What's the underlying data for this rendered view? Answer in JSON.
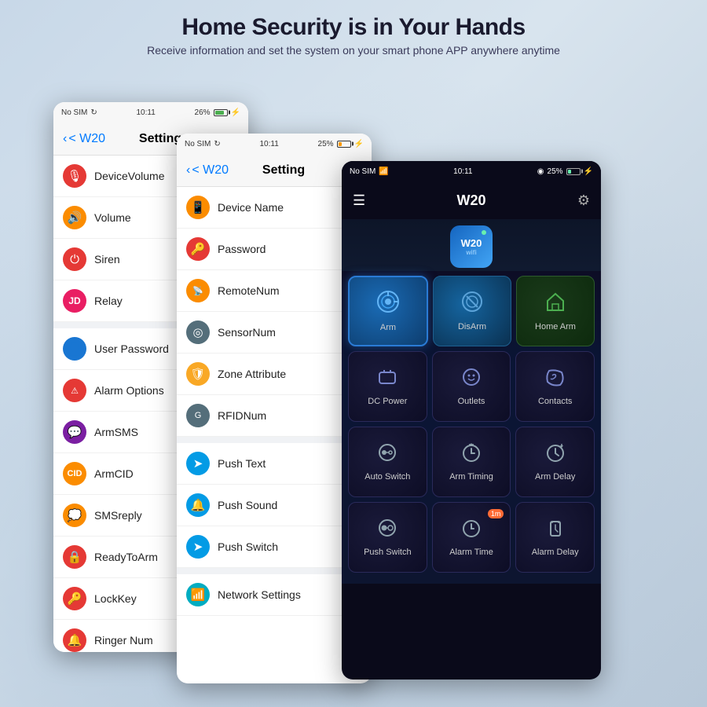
{
  "header": {
    "title": "Home Security is in Your Hands",
    "subtitle": "Receive information and set the system on your smart phone APP anywhere anytime"
  },
  "screen1": {
    "status": {
      "sim": "No SIM",
      "time": "10:11",
      "battery": "26%"
    },
    "nav": {
      "back": "< W20",
      "title": "Setting"
    },
    "items": [
      {
        "label": "DeviceVolume",
        "icon": "mic",
        "color": "icon-red"
      },
      {
        "label": "Volume",
        "icon": "volume",
        "color": "icon-orange",
        "hasBar": true
      },
      {
        "label": "Siren",
        "icon": "power",
        "color": "icon-red"
      },
      {
        "label": "Relay",
        "icon": "relay",
        "color": "icon-pink"
      },
      {
        "label": "User Password",
        "icon": "user",
        "color": "icon-blue"
      },
      {
        "label": "Alarm Options",
        "icon": "alarm",
        "color": "icon-red"
      },
      {
        "label": "ArmSMS",
        "icon": "sms",
        "color": "icon-purple"
      },
      {
        "label": "ArmCID",
        "icon": "cid",
        "color": "icon-orange"
      },
      {
        "label": "SMSreply",
        "icon": "reply",
        "color": "icon-orange"
      },
      {
        "label": "ReadyToArm",
        "icon": "ready",
        "color": "icon-red"
      },
      {
        "label": "LockKey",
        "icon": "lock",
        "color": "icon-red"
      },
      {
        "label": "Ringer Num",
        "icon": "ringer",
        "color": "icon-red"
      }
    ]
  },
  "screen2": {
    "status": {
      "sim": "No SIM",
      "time": "10:11",
      "battery": "25%"
    },
    "nav": {
      "back": "< W20",
      "title": "Setting"
    },
    "items": [
      {
        "label": "Device Name",
        "icon": "device",
        "color": "icon-orange"
      },
      {
        "label": "Password",
        "icon": "key",
        "color": "icon-red"
      },
      {
        "label": "RemoteNum",
        "icon": "remote",
        "color": "icon-orange"
      },
      {
        "label": "SensorNum",
        "icon": "sensor",
        "color": "icon-gray"
      },
      {
        "label": "Zone Attribute",
        "icon": "zone",
        "color": "icon-amber"
      },
      {
        "label": "RFIDNum",
        "icon": "rfid",
        "color": "icon-gray"
      },
      {
        "label": "Push Text",
        "icon": "pushtext",
        "color": "icon-blue"
      },
      {
        "label": "Push Sound",
        "icon": "pushsound",
        "color": "icon-blue"
      },
      {
        "label": "Push Switch",
        "icon": "pushswitch",
        "color": "icon-blue"
      },
      {
        "label": "Network Settings",
        "icon": "network",
        "color": "icon-cyan"
      }
    ]
  },
  "screen3": {
    "status": {
      "sim": "No SIM",
      "time": "10:11",
      "battery": "25%"
    },
    "nav": {
      "title": "W20"
    },
    "device": {
      "name": "W20",
      "wifi": true
    },
    "buttons": [
      [
        {
          "label": "Arm",
          "icon": "arm"
        },
        {
          "label": "DisArm",
          "icon": "disarm"
        },
        {
          "label": "Home Arm",
          "icon": "homearm"
        }
      ],
      [
        {
          "label": "DC Power",
          "icon": "dcpower"
        },
        {
          "label": "Outlets",
          "icon": "outlets"
        },
        {
          "label": "Contacts",
          "icon": "contacts"
        }
      ],
      [
        {
          "label": "Auto Switch",
          "icon": "autoswitch"
        },
        {
          "label": "Arm Timing",
          "icon": "armtiming"
        },
        {
          "label": "Arm Delay",
          "icon": "armdelay"
        }
      ],
      [
        {
          "label": "Push Switch",
          "icon": "pushswitch",
          "badge": null
        },
        {
          "label": "Alarm Time",
          "icon": "alarmtime",
          "badge": "1m"
        },
        {
          "label": "Alarm Delay",
          "icon": "alarmdelay",
          "badge": null
        }
      ]
    ]
  }
}
